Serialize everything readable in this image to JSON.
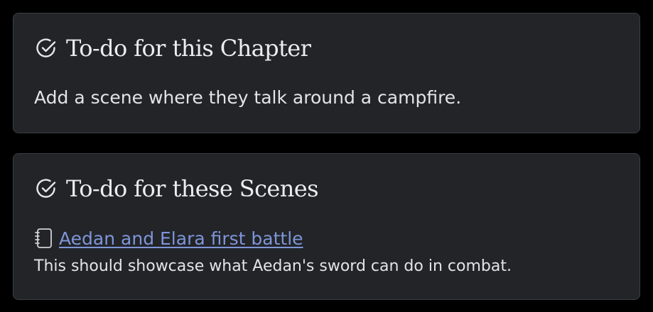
{
  "chapter_todo": {
    "title": "To-do for this Chapter",
    "text": "Add a scene where they talk around a campfire.",
    "icon": "check-circle-icon"
  },
  "scenes_todo": {
    "title": "To-do for these Scenes",
    "icon": "check-circle-icon",
    "items": [
      {
        "link_label": "Aedan and Elara first battle",
        "icon": "notebook-icon",
        "note": "This should showcase what Aedan's sword can do in combat."
      }
    ]
  },
  "colors": {
    "background": "#000000",
    "card": "#222428",
    "card_border": "#3a3d43",
    "text": "#e3e4e8",
    "link": "#7f95d8"
  }
}
